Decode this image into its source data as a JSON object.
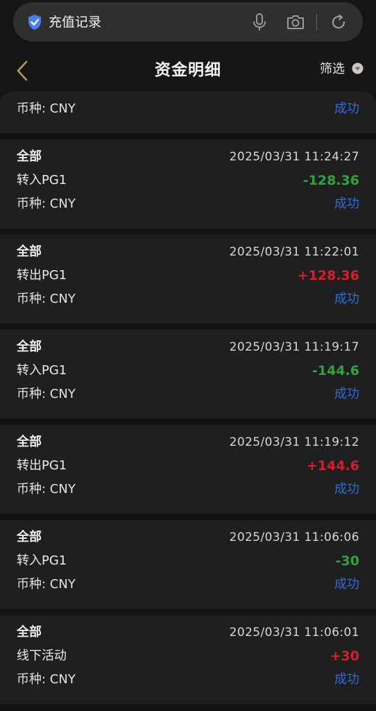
{
  "browser": {
    "search_text": "充值记录"
  },
  "header": {
    "title": "资金明细",
    "filter_label": "筛选"
  },
  "partial_record": {
    "currency": "币种: CNY",
    "status": "成功"
  },
  "records": [
    {
      "category": "全部",
      "time": "2025/03/31 11:24:27",
      "description": "转入PG1",
      "amount": "-128.36",
      "currency": "币种: CNY",
      "status": "成功"
    },
    {
      "category": "全部",
      "time": "2025/03/31 11:22:01",
      "description": "转出PG1",
      "amount": "+128.36",
      "currency": "币种: CNY",
      "status": "成功"
    },
    {
      "category": "全部",
      "time": "2025/03/31 11:19:17",
      "description": "转入PG1",
      "amount": "-144.6",
      "currency": "币种: CNY",
      "status": "成功"
    },
    {
      "category": "全部",
      "time": "2025/03/31 11:19:12",
      "description": "转出PG1",
      "amount": "+144.6",
      "currency": "币种: CNY",
      "status": "成功"
    },
    {
      "category": "全部",
      "time": "2025/03/31 11:06:06",
      "description": "转入PG1",
      "amount": "-30",
      "currency": "币种: CNY",
      "status": "成功"
    },
    {
      "category": "全部",
      "time": "2025/03/31 11:06:01",
      "description": "线下活动",
      "amount": "+30",
      "currency": "币种: CNY",
      "status": "成功"
    }
  ],
  "colors": {
    "positive": "#d3202d",
    "negative": "#2ea63b",
    "status": "#2f6ed8"
  }
}
